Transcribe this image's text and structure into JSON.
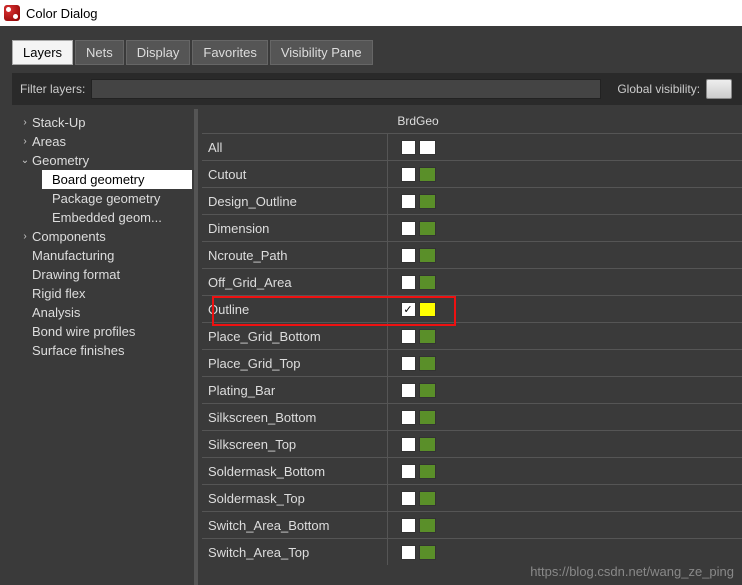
{
  "window_title": "Color Dialog",
  "tabs": {
    "t0": "Layers",
    "t1": "Nets",
    "t2": "Display",
    "t3": "Favorites",
    "t4": "Visibility Pane"
  },
  "filter_label": "Filter layers:",
  "global_visibility_label": "Global visibility:",
  "tree": {
    "stackup": "Stack-Up",
    "areas": "Areas",
    "geometry": "Geometry",
    "board_geometry": "Board geometry",
    "package_geometry": "Package geometry",
    "embedded_geom": "Embedded geom...",
    "components": "Components",
    "manufacturing": "Manufacturing",
    "drawing_format": "Drawing format",
    "rigid_flex": "Rigid flex",
    "analysis": "Analysis",
    "bond_wire": "Bond wire profiles",
    "surface_finishes": "Surface finishes"
  },
  "grid_col": "BrdGeo",
  "rows": [
    {
      "name": "All",
      "checked": false,
      "color": "#ffffff",
      "special": "all"
    },
    {
      "name": "Cutout",
      "checked": false,
      "color": "#5a8f29"
    },
    {
      "name": "Design_Outline",
      "checked": false,
      "color": "#5a8f29"
    },
    {
      "name": "Dimension",
      "checked": false,
      "color": "#5a8f29"
    },
    {
      "name": "Ncroute_Path",
      "checked": false,
      "color": "#5a8f29"
    },
    {
      "name": "Off_Grid_Area",
      "checked": false,
      "color": "#5a8f29"
    },
    {
      "name": "Outline",
      "checked": true,
      "color": "#ffff00"
    },
    {
      "name": "Place_Grid_Bottom",
      "checked": false,
      "color": "#5a8f29"
    },
    {
      "name": "Place_Grid_Top",
      "checked": false,
      "color": "#5a8f29"
    },
    {
      "name": "Plating_Bar",
      "checked": false,
      "color": "#5a8f29"
    },
    {
      "name": "Silkscreen_Bottom",
      "checked": false,
      "color": "#5a8f29"
    },
    {
      "name": "Silkscreen_Top",
      "checked": false,
      "color": "#5a8f29"
    },
    {
      "name": "Soldermask_Bottom",
      "checked": false,
      "color": "#5a8f29"
    },
    {
      "name": "Soldermask_Top",
      "checked": false,
      "color": "#5a8f29"
    },
    {
      "name": "Switch_Area_Bottom",
      "checked": false,
      "color": "#5a8f29"
    },
    {
      "name": "Switch_Area_Top",
      "checked": false,
      "color": "#5a8f29"
    }
  ],
  "watermark": "https://blog.csdn.net/wang_ze_ping"
}
